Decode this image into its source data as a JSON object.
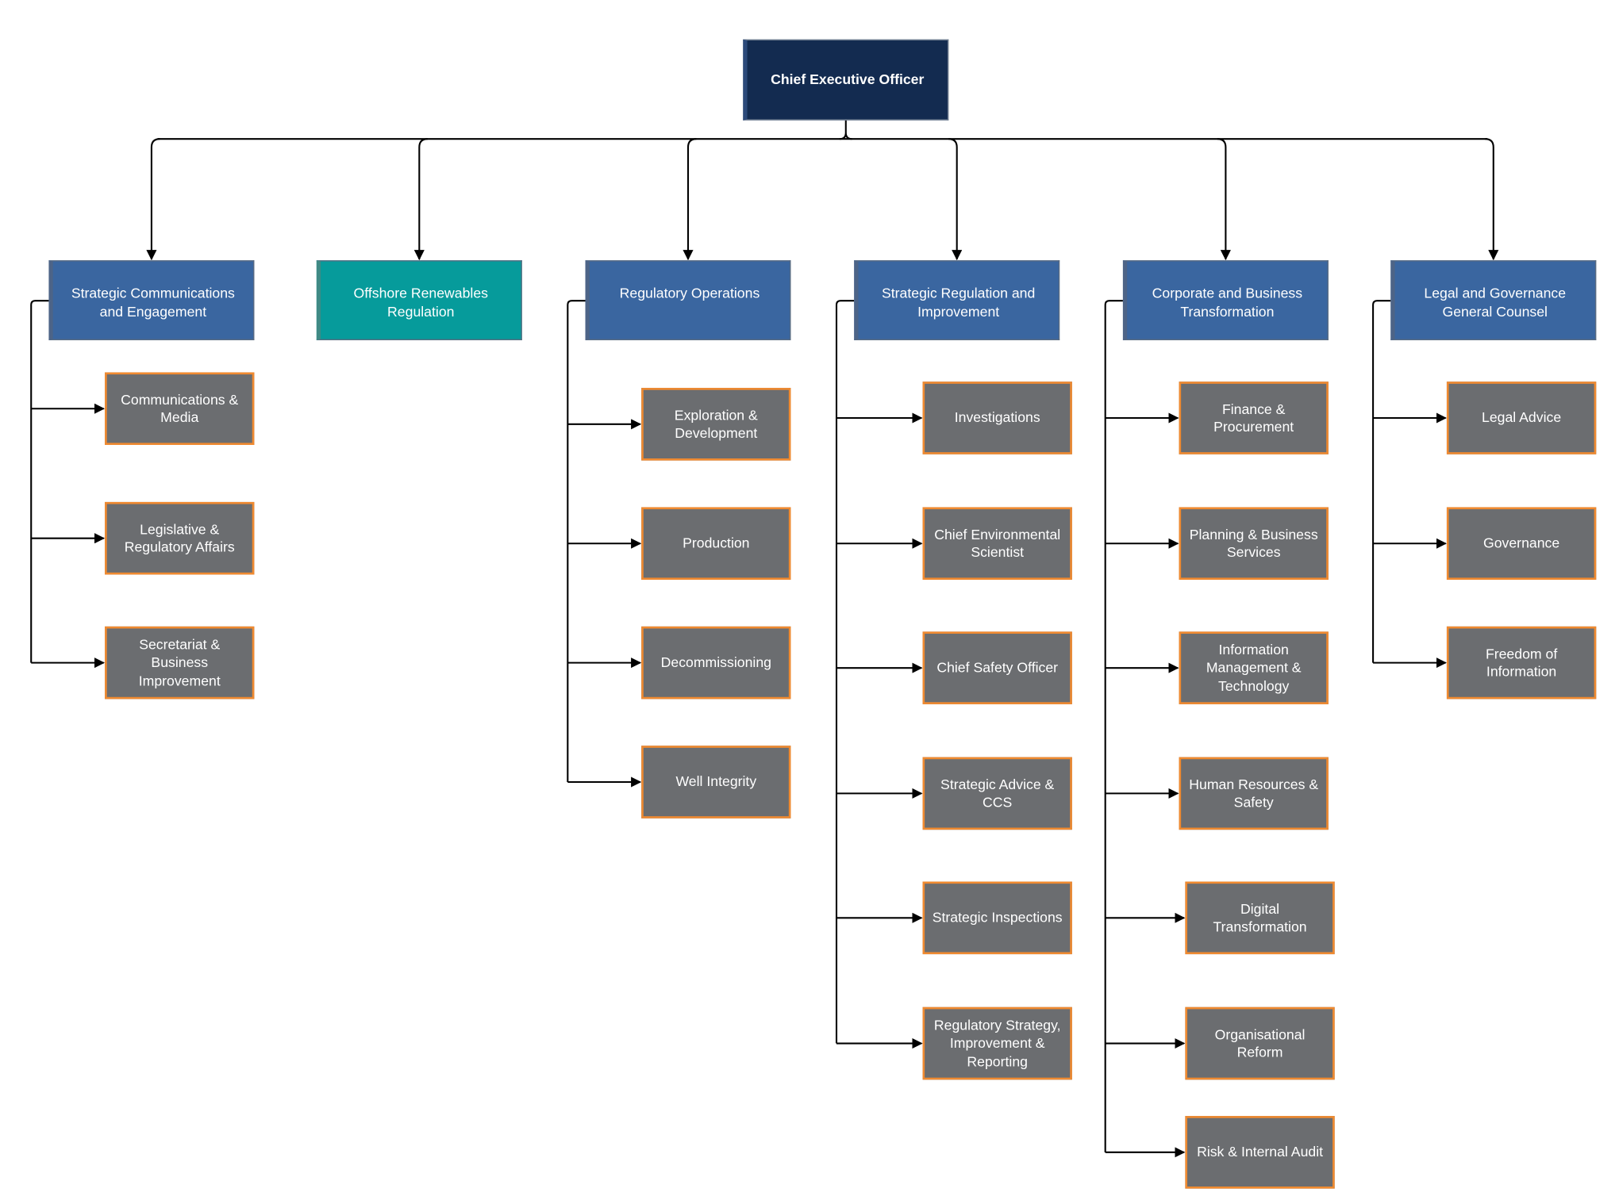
{
  "colors": {
    "ceo": "#132b50",
    "division": "#3a66a0",
    "offshore": "#069b9b",
    "unit": "#6b6d70",
    "unit_border": "#f08a30",
    "connector": "#000000"
  },
  "ceo": {
    "label": "Chief Executive Officer"
  },
  "divisions": [
    {
      "label": "Strategic Communications and Engagement",
      "children": [
        "Communications & Media",
        "Legislative & Regulatory Affairs",
        "Secretariat & Business Improvement"
      ]
    },
    {
      "label": "Offshore Renewables Regulation",
      "children": []
    },
    {
      "label": "Regulatory Operations",
      "children": [
        "Exploration & Development",
        "Production",
        "Decommissioning",
        "Well Integrity"
      ]
    },
    {
      "label": "Strategic Regulation and Improvement",
      "children": [
        "Investigations",
        "Chief Environmental Scientist",
        "Chief Safety Officer",
        "Strategic Advice & CCS",
        "Strategic Inspections",
        "Regulatory Strategy, Improvement & Reporting"
      ]
    },
    {
      "label": "Corporate and Business Transformation",
      "children": [
        "Finance & Procurement",
        "Planning & Business Services",
        "Information Management & Technology",
        "Human Resources & Safety",
        "Digital Transformation",
        "Organisational Reform",
        "Risk & Internal Audit"
      ]
    },
    {
      "label": "Legal and Governance General Counsel",
      "children": [
        "Legal Advice",
        "Governance",
        "Freedom of Information"
      ]
    }
  ]
}
